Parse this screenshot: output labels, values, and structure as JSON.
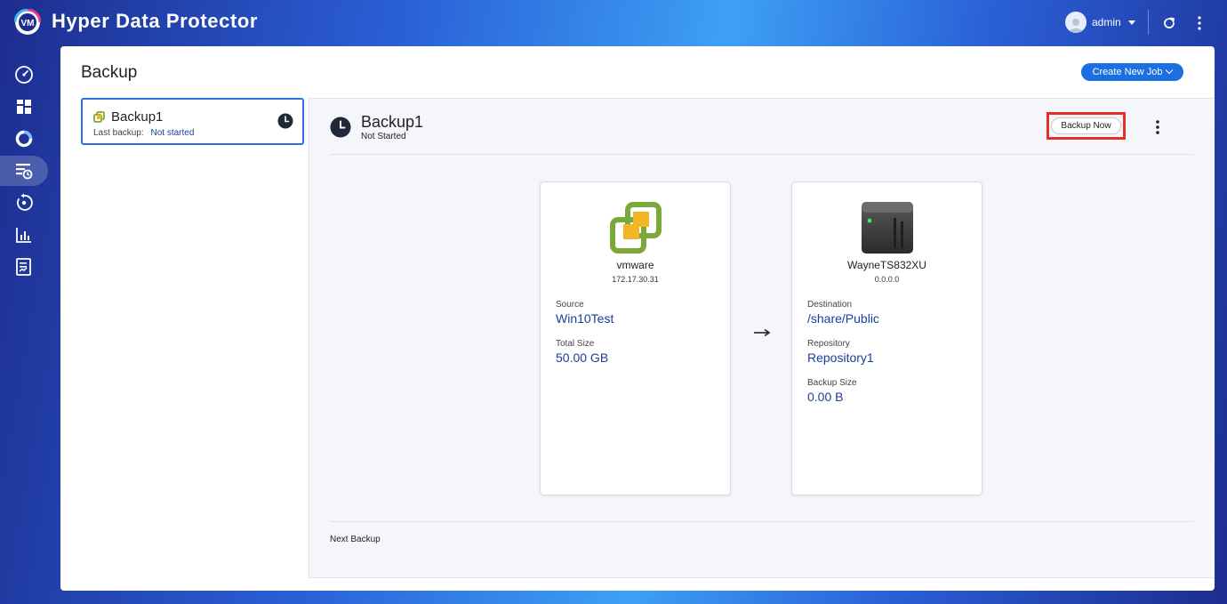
{
  "app": {
    "title": "Hyper Data Protector"
  },
  "header": {
    "user": "admin"
  },
  "sidebar": {
    "items": [
      {
        "icon": "dashboard-gauge-icon"
      },
      {
        "icon": "grid-overview-icon"
      },
      {
        "icon": "storage-ring-icon"
      },
      {
        "icon": "backup-list-icon",
        "active": true
      },
      {
        "icon": "restore-icon"
      },
      {
        "icon": "report-chart-icon"
      },
      {
        "icon": "log-document-icon"
      }
    ]
  },
  "page": {
    "title": "Backup",
    "create_button": "Create New Job"
  },
  "job_list": [
    {
      "name": "Backup1",
      "last_backup_label": "Last backup:",
      "last_backup_value": "Not started"
    }
  ],
  "detail": {
    "name": "Backup1",
    "status": "Not Started",
    "backup_now": "Backup Now",
    "source": {
      "title": "vmware",
      "ip": "172.17.30.31",
      "source_label": "Source",
      "source_value": "Win10Test",
      "size_label": "Total Size",
      "size_value": "50.00 GB"
    },
    "destination": {
      "title": "WayneTS832XU",
      "ip": "0.0.0.0",
      "dest_label": "Destination",
      "dest_value": "/share/Public",
      "repo_label": "Repository",
      "repo_value": "Repository1",
      "size_label": "Backup Size",
      "size_value": "0.00 B"
    },
    "next_backup_label": "Next Backup"
  },
  "colors": {
    "accent": "#1c6fe0",
    "highlight": "#e53125",
    "value_text": "#1a3e9a"
  }
}
